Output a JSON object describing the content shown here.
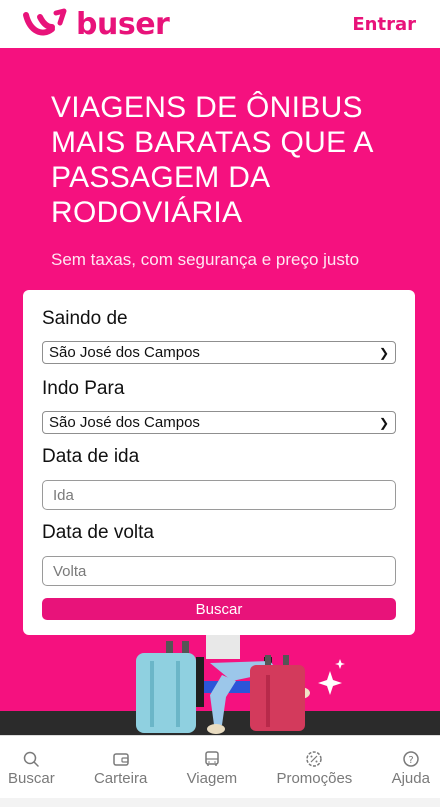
{
  "brand": {
    "name": "buser",
    "color": "#e8137a"
  },
  "header": {
    "login_label": "Entrar"
  },
  "hero": {
    "headline": "VIAGENS DE ÔNIBUS MAIS BARATAS QUE A PASSAGEM DA RODOVIÁRIA",
    "subtitle": "Sem taxas, com segurança e preço justo",
    "background": "#f5117f"
  },
  "search_form": {
    "origin_label": "Saindo de",
    "origin_value": "São José dos Campos",
    "destination_label": "Indo Para",
    "destination_value": "São José dos Campos",
    "departure_label": "Data de ida",
    "departure_placeholder": "Ida",
    "return_label": "Data de volta",
    "return_placeholder": "Volta",
    "submit_label": "Buscar"
  },
  "bottom_nav": {
    "items": [
      {
        "label": "Buscar",
        "icon": "search-icon"
      },
      {
        "label": "Carteira",
        "icon": "wallet-icon"
      },
      {
        "label": "Viagem",
        "icon": "bus-icon"
      },
      {
        "label": "Promoções",
        "icon": "discount-icon"
      },
      {
        "label": "Ajuda",
        "icon": "help-icon"
      }
    ]
  }
}
